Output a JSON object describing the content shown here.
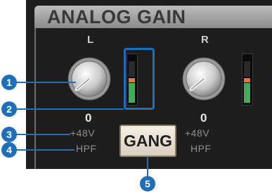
{
  "panel": {
    "title": "ANALOG GAIN"
  },
  "left_channel": {
    "label": "L",
    "gain_value": "0",
    "phantom_label": "+48V",
    "hpf_label": "HPF"
  },
  "right_channel": {
    "label": "R",
    "gain_value": "0",
    "phantom_label": "+48V",
    "hpf_label": "HPF"
  },
  "gang_button": {
    "label": "GANG"
  },
  "callouts": [
    "1",
    "2",
    "3",
    "4",
    "5"
  ],
  "colors": {
    "panel_bg": "#1d1d1d",
    "title_bar": "#a6a6a6",
    "callout_blue": "#1f6fb8",
    "meter_green": "#3fae5a",
    "meter_orange": "#e0793a",
    "gang_button_bg": "#ece5d6"
  }
}
